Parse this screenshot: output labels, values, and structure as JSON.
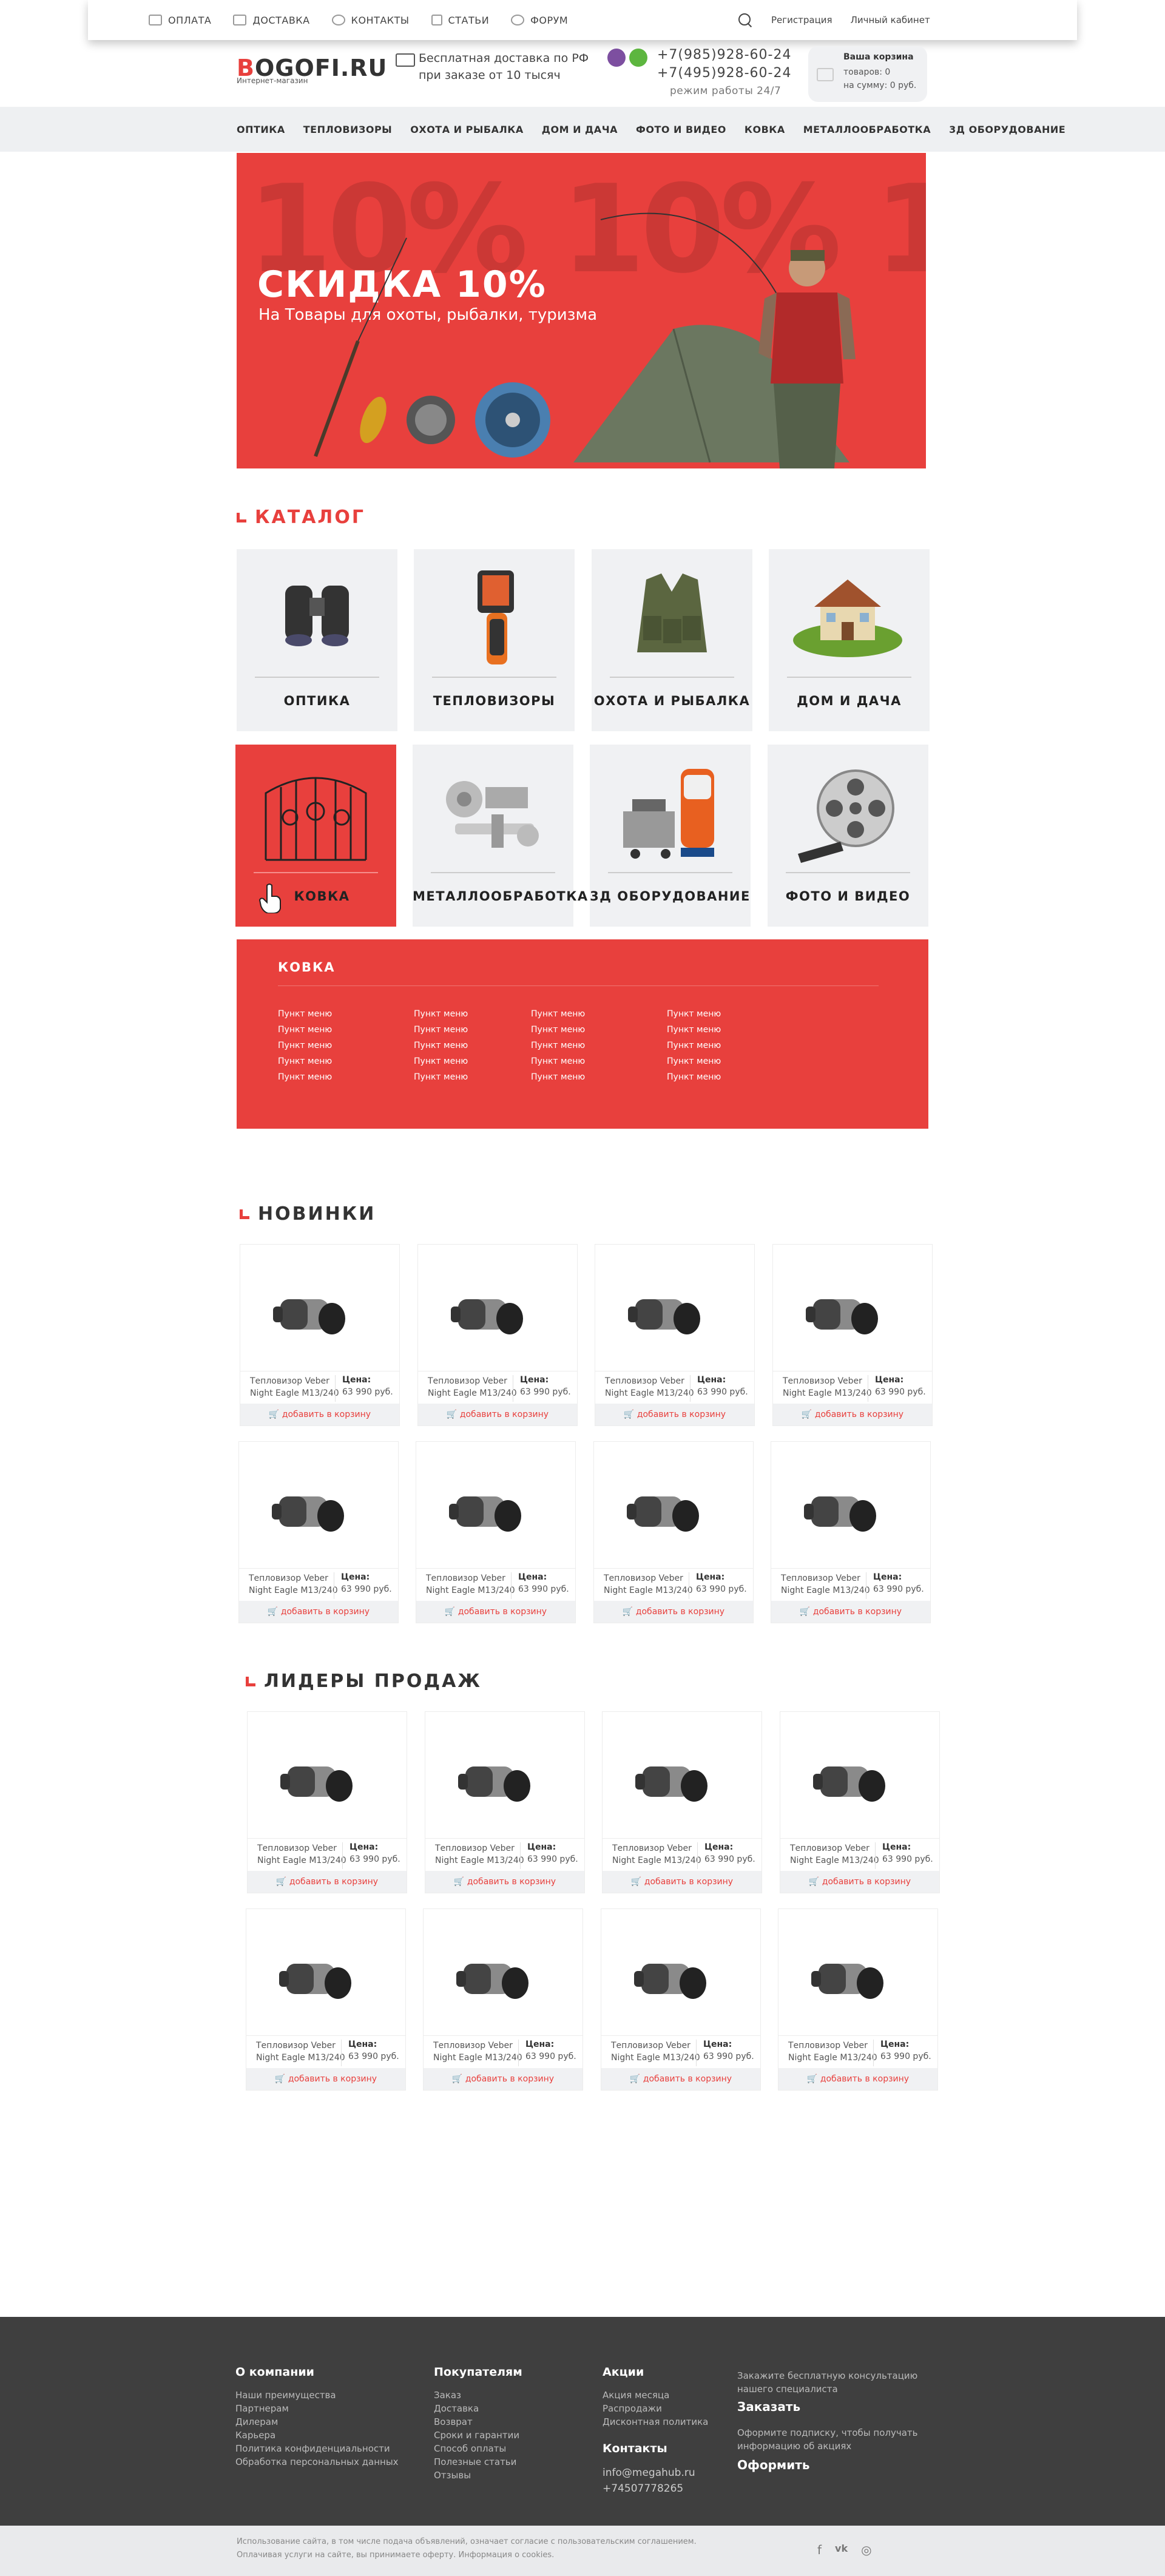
{
  "topbar": {
    "nav": [
      {
        "label": "ОПЛАТА",
        "icon": "wallet-icon"
      },
      {
        "label": "ДОСТАВКА",
        "icon": "truck-icon"
      },
      {
        "label": "КОНТАКТЫ",
        "icon": "phone-icon"
      },
      {
        "label": "СТАТЬИ",
        "icon": "document-icon"
      },
      {
        "label": "ФОРУМ",
        "icon": "chat-icon"
      }
    ],
    "register": "Регистрация",
    "account": "Личный кабинет"
  },
  "header": {
    "logo_first": "B",
    "logo_rest": "OGOFI.RU",
    "logo_sub": "Интернет-магазин",
    "delivery_line1": "Бесплатная доставка по РФ",
    "delivery_line2": "при заказе от 10 тысяч",
    "phone1": "+7(985)928-60-24",
    "phone2": "+7(495)928-60-24",
    "hours": "режим работы 24/7",
    "cart_title": "Ваша корзина",
    "cart_items": "товаров: 0",
    "cart_sum": "на сумму: 0 руб.",
    "viber_color": "#7d4fa0",
    "whatsapp_color": "#5db63f"
  },
  "mainnav": [
    "ОПТИКА",
    "ТЕПЛОВИЗОРЫ",
    "ОХОТА И РЫБАЛКА",
    "ДОМ И ДАЧА",
    "ФОТО И ВИДЕО",
    "КОВКА",
    "МЕТАЛЛООБРАБОТКА",
    "3Д ОБОРУДОВАНИЕ"
  ],
  "banner": {
    "bg_text": "10% 10% 10%",
    "heading": "СКИДКА 10%",
    "subheading": "На Товары для охоты, рыбалки, туризма",
    "color": "#e8403d"
  },
  "catalog": {
    "title": "КАТАЛОГ",
    "items": [
      {
        "label": "ОПТИКА",
        "icon": "binoculars-icon"
      },
      {
        "label": "ТЕПЛОВИЗОРЫ",
        "icon": "thermal-camera-icon"
      },
      {
        "label": "ОХОТА И РЫБАЛКА",
        "icon": "vest-icon"
      },
      {
        "label": "ДОМ И ДАЧА",
        "icon": "house-icon"
      },
      {
        "label": "КОВКА",
        "icon": "gate-icon"
      },
      {
        "label": "МЕТАЛЛООБРАБОТКА",
        "icon": "metal-parts-icon"
      },
      {
        "label": "3Д ОБОРУДОВАНИЕ",
        "icon": "3d-printer-icon"
      },
      {
        "label": "ФОТО И ВИДЕО",
        "icon": "film-reel-icon"
      }
    ],
    "dropdown_title": "КОВКА",
    "menu_item": "Пункт меню"
  },
  "new_title": "НОВИНКИ",
  "leaders_title": "ЛИДЕРЫ ПРОДАЖ",
  "product": {
    "name1": "Тепловизор Veber",
    "name2": "Night Eagle M13/240",
    "price_label": "Цена:",
    "price": "63 990 руб.",
    "add": "добавить в корзину"
  },
  "footer": {
    "col1_title": "О компании",
    "col1": [
      "Наши преимущества",
      "Партнерам",
      "Дилерам",
      "Карьера",
      "Политика конфиденциальности",
      "Обработка персональных данных"
    ],
    "col2_title": "Покупателям",
    "col2": [
      "Заказ",
      "Доставка",
      "Возврат",
      "Сроки и гарантии",
      "Способ оплаты",
      "Полезные статьи",
      "Отзывы"
    ],
    "col3_title": "Акции",
    "col3": [
      "Акция месяца",
      "Распродажи",
      "Дисконтная политика"
    ],
    "contacts_title": "Контакты",
    "email": "info@megahub.ru",
    "phone": "+74507778265",
    "consult_line1": "Закажите бесплатную консультацию",
    "consult_line2": "нашего специалиста",
    "consult_btn": "Заказать",
    "subscribe_line1": "Оформите подписку, чтобы получать",
    "subscribe_line2": "информацию об акциях",
    "subscribe_btn": "Оформить"
  },
  "bottom": {
    "line1": "Использование сайта, в том числе подача объявлений, означает согласие с пользовательским соглашением.",
    "line2": "Оплачивая услуги на сайте, вы принимаете оферту. Информация о cookies.",
    "social": [
      "facebook-icon",
      "vk-icon",
      "instagram-icon"
    ]
  }
}
